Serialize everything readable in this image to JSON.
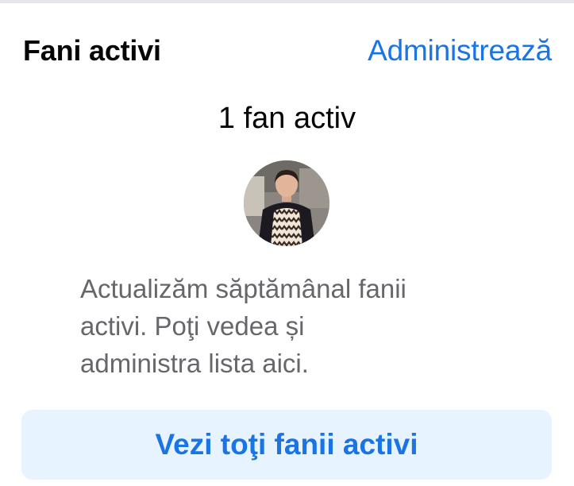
{
  "section": {
    "title": "Fani activi",
    "manage_label": "Administrează",
    "count_text": "1 fan activ",
    "avatar_icon": "profile-photo",
    "description_lines": [
      "Actualizăm săptămânal fanii",
      "activi. Poţi vedea și",
      "administra lista aici."
    ],
    "button_label": "Vezi toţi fanii activi"
  },
  "colors": {
    "accent": "#1b74e4",
    "button_bg": "#e7f3ff",
    "secondary_text": "#65676b",
    "primary_text": "#050505"
  }
}
